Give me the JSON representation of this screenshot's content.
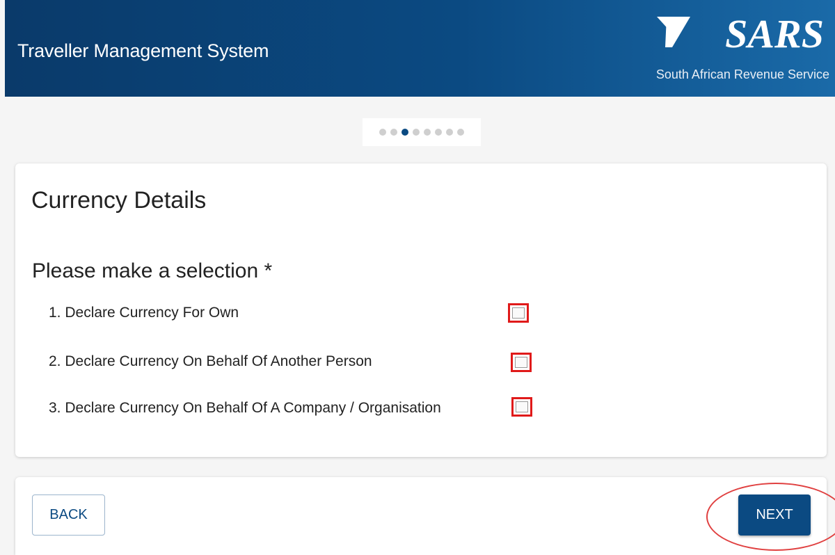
{
  "header": {
    "title": "Traveller Management System",
    "logo_text": "SARS",
    "logo_subtitle": "South African Revenue Service",
    "bg_color": "#0b4a82"
  },
  "stepper": {
    "total_steps": 8,
    "active_step": 3
  },
  "form": {
    "title": "Currency Details",
    "prompt": "Please make a selection *",
    "options": [
      {
        "label": "1. Declare Currency For Own",
        "checked": false
      },
      {
        "label": "2. Declare Currency On Behalf Of Another Person",
        "checked": false
      },
      {
        "label": "3. Declare Currency On Behalf Of A Company / Organisation",
        "checked": false
      }
    ]
  },
  "actions": {
    "back_label": "BACK",
    "next_label": "NEXT"
  },
  "annotation_color": "#e01a1a"
}
